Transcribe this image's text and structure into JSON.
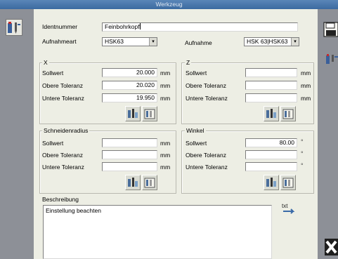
{
  "window": {
    "title": "Werkzeug"
  },
  "form": {
    "identnummer_label": "Identnummer",
    "identnummer_value": "Feinbohrkopf",
    "aufnahmeart_label": "Aufnahmeart",
    "aufnahmeart_value": "HSK63",
    "aufnahme_label": "Aufnahme",
    "aufnahme_value": "HSK 63|HSK63"
  },
  "labels": {
    "sollwert": "Sollwert",
    "obere_toleranz": "Obere Toleranz",
    "untere_toleranz": "Untere Toleranz"
  },
  "groups": {
    "x": {
      "title": "X",
      "unit": "mm",
      "sollwert": "20.000",
      "obere": "20.020",
      "untere": "19.950"
    },
    "z": {
      "title": "Z",
      "unit": "mm",
      "sollwert": "",
      "obere": "",
      "untere": ""
    },
    "schneidenradius": {
      "title": "Schneidenradius",
      "unit": "mm",
      "sollwert": "",
      "obere": "",
      "untere": ""
    },
    "winkel": {
      "title": "Winkel",
      "unit": "°",
      "sollwert": "80.00",
      "obere": "",
      "untere": ""
    }
  },
  "beschreibung": {
    "title": "Beschreibung",
    "text": "Einstellung beachten"
  },
  "icons": {
    "tool_left": "tool-icon",
    "save": "save-icon",
    "tool_right": "tool-icon",
    "calculator": "calculator-icon",
    "measure": "measure-icon",
    "edit_text": "edit-text-icon",
    "close": "close-icon"
  },
  "colors": {
    "titlebar": "#3b6aa0",
    "panel": "#edeee4",
    "frame": "#9d9fa6"
  }
}
